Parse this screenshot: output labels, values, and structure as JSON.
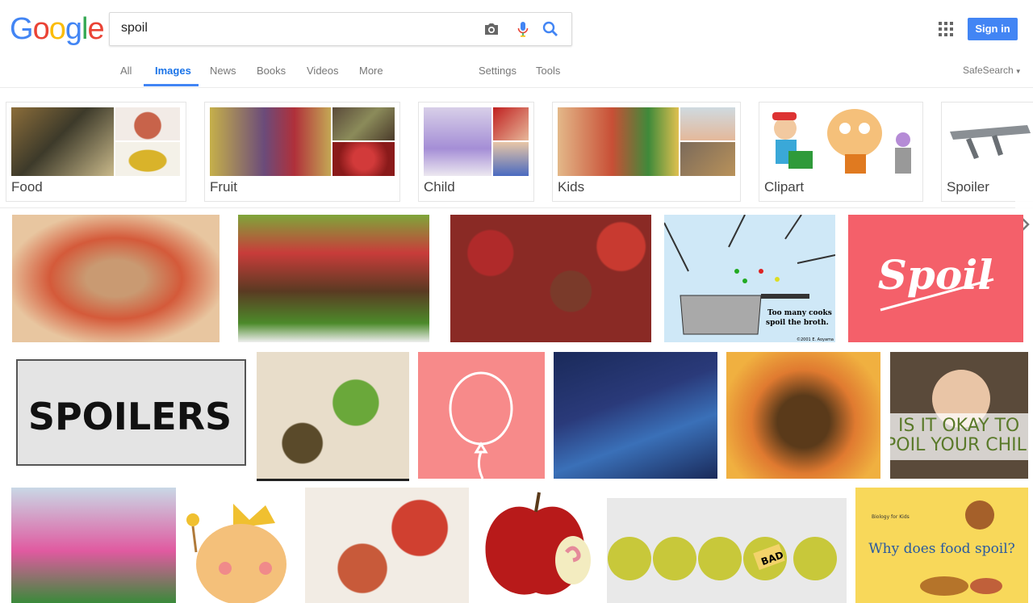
{
  "logo": "Google",
  "search": {
    "value": "spoil"
  },
  "header": {
    "sign_in": "Sign in"
  },
  "tabs": [
    {
      "label": "All"
    },
    {
      "label": "Images"
    },
    {
      "label": "News"
    },
    {
      "label": "Books"
    },
    {
      "label": "Videos"
    },
    {
      "label": "More"
    },
    {
      "label": "Settings"
    },
    {
      "label": "Tools"
    }
  ],
  "safesearch": "SafeSearch",
  "chips": [
    {
      "label": "Food"
    },
    {
      "label": "Fruit"
    },
    {
      "label": "Child"
    },
    {
      "label": "Kids"
    },
    {
      "label": "Clipart"
    },
    {
      "label": "Spoiler"
    }
  ],
  "results": {
    "spoil_text": "Spoil",
    "cooks_caption_1": "Too many cooks",
    "cooks_caption_2": "spoil the broth.",
    "cooks_credit": "©2001 E. Aoyama",
    "spoilers_text": "SPOILERS",
    "child_text_1": "IS IT OKAY TO",
    "child_text_2": "POIL YOUR CHILD",
    "bad_label": "BAD",
    "biology_small": "Biology for Kids",
    "biology_title": "Why does food spoil?"
  },
  "colors": {
    "link_blue": "#4285f4",
    "active_tab": "#1a73e8",
    "spoil_bg": "#f4606a",
    "balloon_bg": "#f78a8a",
    "biology_bg": "#f8d85a"
  }
}
